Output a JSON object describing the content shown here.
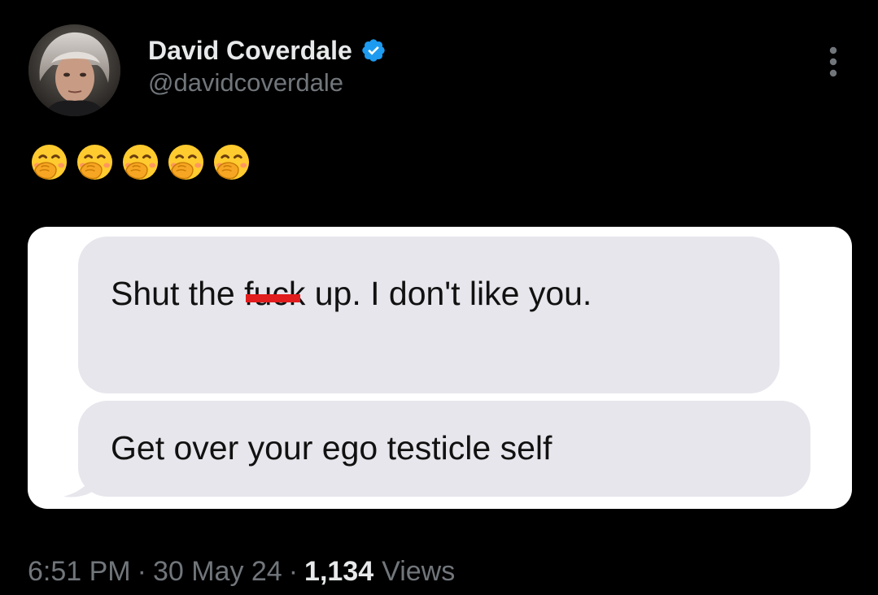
{
  "tweet": {
    "author": {
      "display_name": "David Coverdale",
      "handle": "@davidcoverdale",
      "verified": true,
      "verified_icon": "verified-badge-icon",
      "verified_color": "#1d9bf0"
    },
    "more_icon": "more-vertical-icon",
    "emoji": [
      "🤭",
      "🤭",
      "🤭",
      "🤭",
      "🤭"
    ],
    "media": {
      "message_1_before": "Shut the ",
      "message_1_censored": "fuck",
      "message_1_after": " up. I don't like you.",
      "message_2": "Get over your ego testicle self",
      "censor_color": "#e11d1d",
      "bubble_color": "#e6e6ec"
    },
    "meta": {
      "time": "6:51 PM",
      "separator": "·",
      "date": "30 May 24",
      "views_count": "1,134",
      "views_label": "Views"
    }
  }
}
